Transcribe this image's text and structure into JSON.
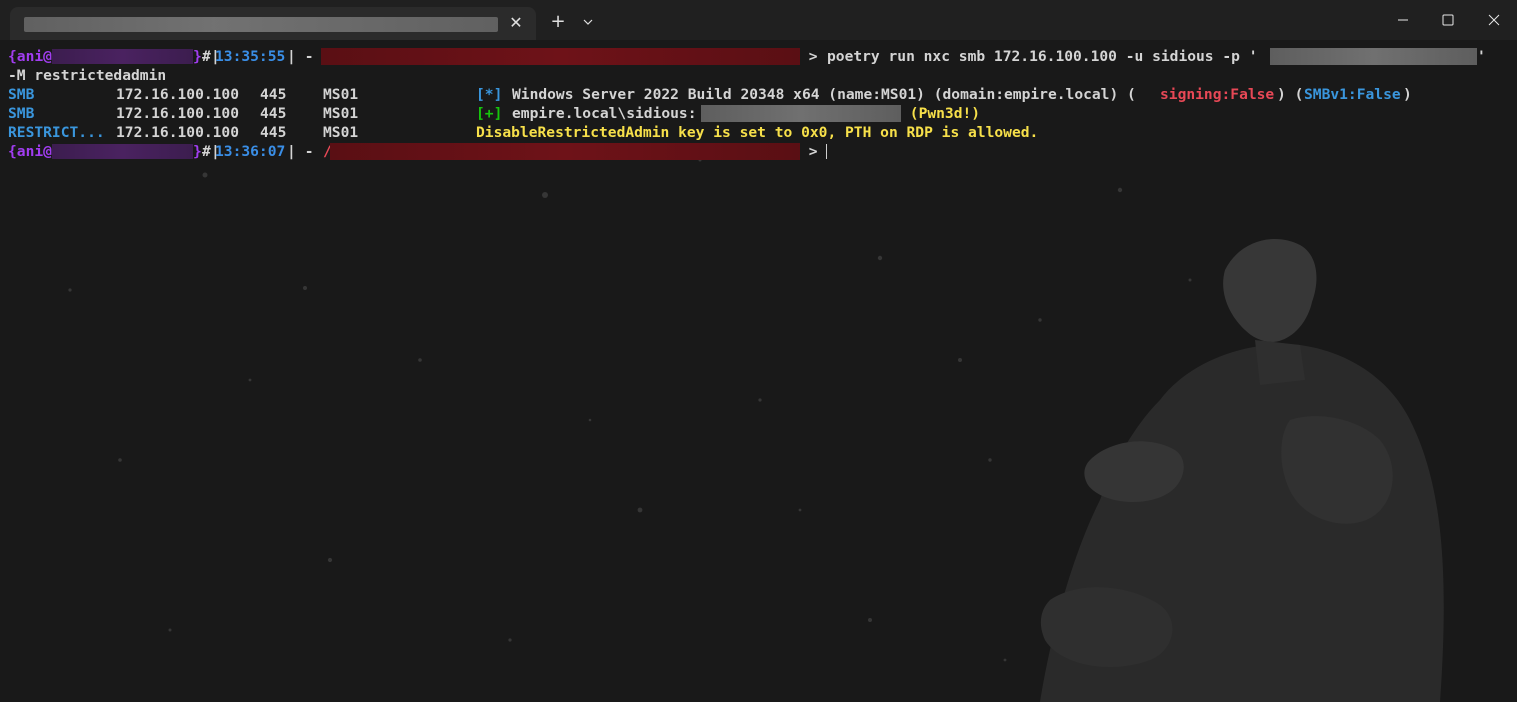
{
  "tab": {
    "close_symbol": "✕",
    "new_tab_symbol": "+"
  },
  "prompt1": {
    "user": "{ani@",
    "close_brace": "}",
    "hash": "#",
    "bar_open": "|",
    "time": "13:35:55",
    "bar_close": "|",
    "dash": " -",
    "arrow": " > ",
    "command": "poetry run nxc smb 172.16.100.100 -u sidious -p '",
    "quote_end": "'",
    "command_cont": "-M restrictedadmin"
  },
  "output": [
    {
      "protocol": "SMB",
      "ip": "172.16.100.100",
      "port": "445",
      "host": "MS01",
      "marker": "[*]",
      "message_prefix": "Windows Server 2022 Build 20348 x64 (name:MS01) (domain:empire.local) (",
      "signing": "signing:False",
      "mid": ") (",
      "smbv1": "SMBv1:False",
      "suffix": ")"
    },
    {
      "protocol": "SMB",
      "ip": "172.16.100.100",
      "port": "445",
      "host": "MS01",
      "marker": "[+]",
      "message_prefix": "empire.local\\sidious:",
      "message_suffix": " (Pwn3d!)"
    },
    {
      "protocol": "RESTRICT...",
      "ip": "172.16.100.100",
      "port": "445",
      "host": "MS01",
      "message": "DisableRestrictedAdmin key is set to 0x0, PTH on RDP is allowed."
    }
  ],
  "prompt2": {
    "user": "{ani@",
    "close_brace": "}",
    "hash": "#",
    "bar_open": "|",
    "time": "13:36:07",
    "bar_close": "|",
    "dash": " -",
    "path_start": "/",
    "arrow": " > "
  },
  "colors": {
    "prompt_user": "#a13df0",
    "time": "#3a8ee6",
    "signing": "#e74856",
    "smbv1": "#3a96dd",
    "success": "#16c60c",
    "highlight": "#f7e04a",
    "background": "#191919"
  }
}
